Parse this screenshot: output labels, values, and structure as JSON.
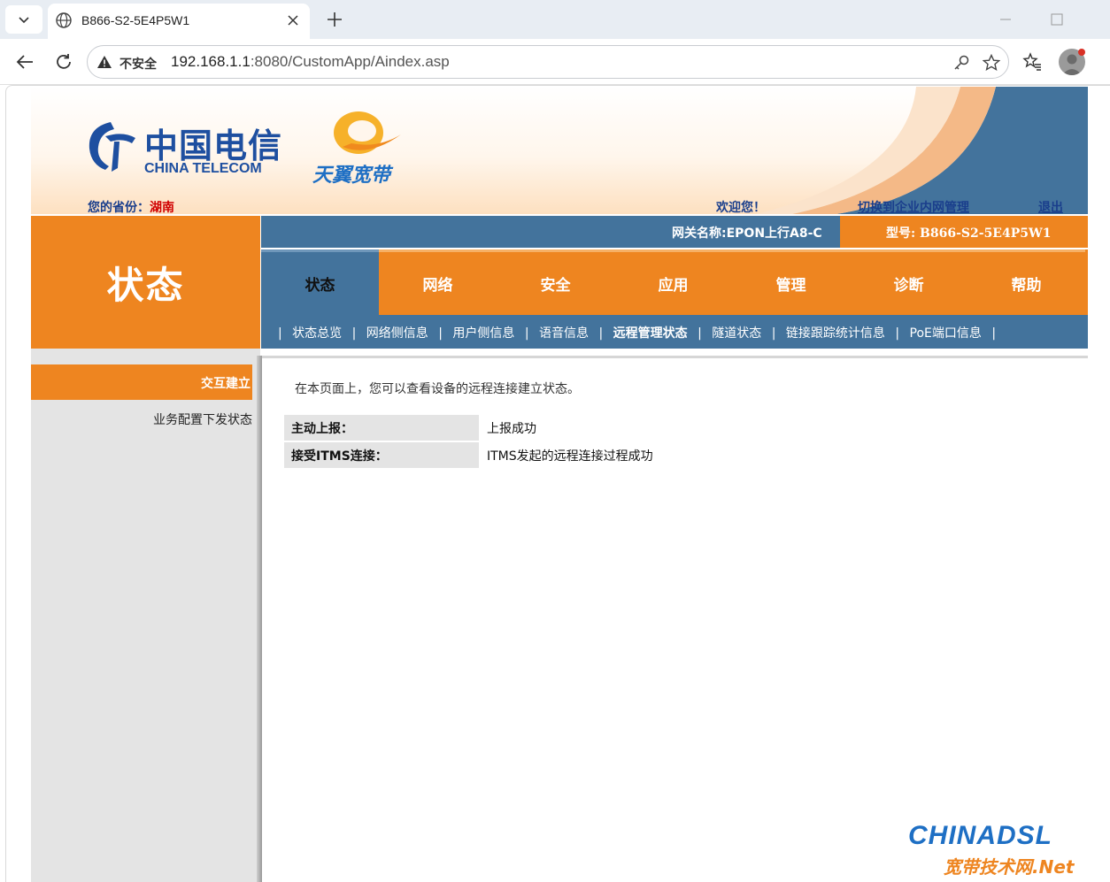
{
  "browser": {
    "tab_title": "B866-S2-5E4P5W1",
    "security_label": "不安全",
    "url_host": "192.168.1.1",
    "url_rest": ":8080/CustomApp/Aindex.asp"
  },
  "header": {
    "brand_cn": "中国电信",
    "brand_en": "CHINA TELECOM",
    "broadband_brand": "天翼宽带",
    "province_label": "您的省份：",
    "province_value": "湖南",
    "welcome": "欢迎您！",
    "switch_link": "切换到企业内网管理",
    "logout": "退出"
  },
  "section_title": "状态",
  "gateway": {
    "name": "网关名称:EPON上行A8-C",
    "model": "型号: B866-S2-5E4P5W1"
  },
  "main_tabs": [
    {
      "label": "状态",
      "active": true
    },
    {
      "label": "网络",
      "active": false
    },
    {
      "label": "安全",
      "active": false
    },
    {
      "label": "应用",
      "active": false
    },
    {
      "label": "管理",
      "active": false
    },
    {
      "label": "诊断",
      "active": false
    },
    {
      "label": "帮助",
      "active": false
    }
  ],
  "sub_tabs": [
    {
      "label": "状态总览",
      "active": false
    },
    {
      "label": "网络侧信息",
      "active": false
    },
    {
      "label": "用户侧信息",
      "active": false
    },
    {
      "label": "语音信息",
      "active": false
    },
    {
      "label": "远程管理状态",
      "active": true
    },
    {
      "label": "隧道状态",
      "active": false
    },
    {
      "label": "链接跟踪统计信息",
      "active": false
    },
    {
      "label": "PoE端口信息",
      "active": false
    }
  ],
  "sidebar": {
    "active_item": "交互建立",
    "item": "业务配置下发状态"
  },
  "content": {
    "intro": "在本页面上，您可以查看设备的远程连接建立状态。",
    "rows": [
      {
        "key": "主动上报：",
        "value": "上报成功"
      },
      {
        "key": "接受ITMS连接：",
        "value": "ITMS发起的远程连接过程成功"
      }
    ]
  },
  "watermark": {
    "top": "CHINADSL",
    "bottom": "宽带技术网.Net"
  },
  "colors": {
    "orange": "#ee8520",
    "steel_blue": "#43739c",
    "telecom_blue": "#1e4fa0",
    "province_red": "#d00000"
  }
}
